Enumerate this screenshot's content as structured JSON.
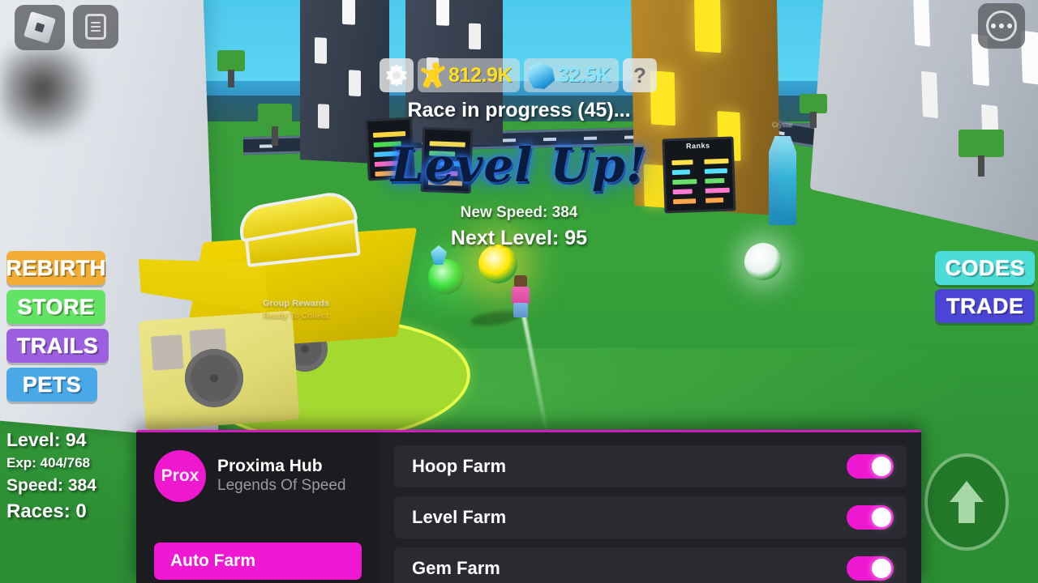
{
  "game": {
    "title": "Legends Of Speed",
    "race_status": "Race in progress (45)...",
    "levelup_banner": "Level Up!",
    "new_speed": "New Speed: 384",
    "next_level": "Next Level: 95",
    "group_reward": "Group Rewards",
    "group_reward_sub": "Ready To Collect",
    "ranks_sign": "Ranks",
    "crystal_sign": "Crystal"
  },
  "currency": {
    "steps_value": "812.9K",
    "steps_icon": "runner-icon",
    "steps_color": "#ffd21e",
    "gems_value": "32.5K",
    "gems_icon": "gem-icon",
    "gems_color": "#8fe8ff"
  },
  "hud_buttons": {
    "settings_icon": "gear-icon",
    "help_label": "?",
    "roblox_icon": "roblox-logo-icon",
    "chat_icon": "chat-icon",
    "more_icon": "more-dots-icon",
    "jump_icon": "up-arrow-icon"
  },
  "side_menu_left": [
    {
      "label": "REBIRTH",
      "color": "#f0ac33"
    },
    {
      "label": "STORE",
      "color": "#63e364"
    },
    {
      "label": "TRAILS",
      "color": "#9b5fe0"
    },
    {
      "label": "PETS",
      "color": "#49a8e8"
    }
  ],
  "side_menu_right": [
    {
      "label": "CODES",
      "color": "#4bdcd8"
    },
    {
      "label": "TRADE",
      "color": "#4b45d6"
    }
  ],
  "stats": {
    "level": "Level: 94",
    "exp": "Exp: 404/768",
    "speed": "Speed: 384",
    "races": "Races: 0"
  },
  "panel": {
    "accent_color": "#ef18d2",
    "avatar_initials": "Prox",
    "hub_name": "Proxima Hub",
    "hub_subtitle": "Legends Of Speed",
    "active_tab": "Auto Farm",
    "rows": [
      {
        "label": "Hoop Farm",
        "state": "on"
      },
      {
        "label": "Level Farm",
        "state": "on"
      },
      {
        "label": "Gem Farm",
        "state": "on"
      }
    ]
  }
}
